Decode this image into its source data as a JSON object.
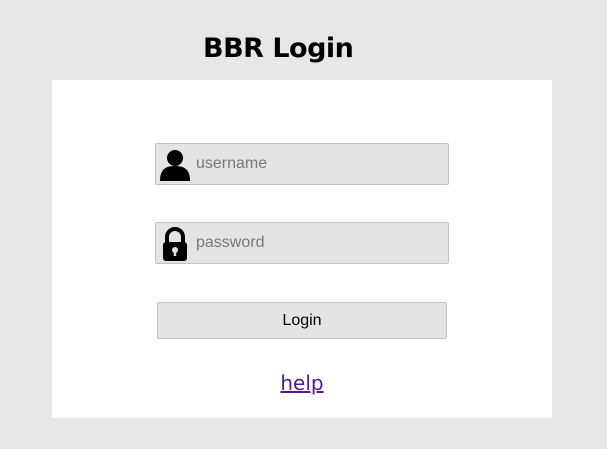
{
  "page": {
    "title": "BBR Login",
    "background_color": "#e7e7e7",
    "card_color": "#ffffff"
  },
  "form": {
    "username": {
      "icon": "user-icon",
      "placeholder": "username",
      "value": ""
    },
    "password": {
      "icon": "lock-icon",
      "placeholder": "password",
      "value": ""
    },
    "login_label": "Login",
    "help_label": "help",
    "help_link_color": "#551a8b"
  }
}
